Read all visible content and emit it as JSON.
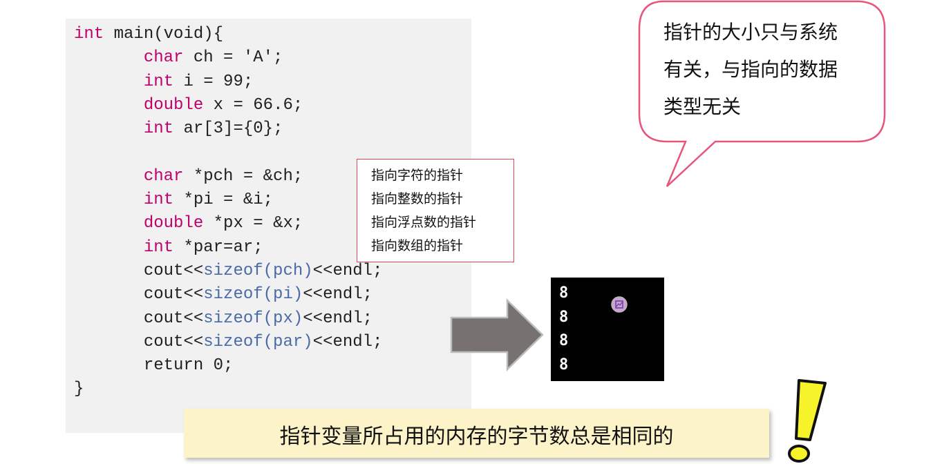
{
  "code": {
    "lines": [
      [
        {
          "t": "int",
          "k": "kw"
        },
        {
          "t": " main(void){",
          "k": ""
        }
      ],
      [
        {
          "t": "       ",
          "k": ""
        },
        {
          "t": "char",
          "k": "kw"
        },
        {
          "t": " ch = 'A';",
          "k": ""
        }
      ],
      [
        {
          "t": "       ",
          "k": ""
        },
        {
          "t": "int",
          "k": "kw"
        },
        {
          "t": " i = 99;",
          "k": ""
        }
      ],
      [
        {
          "t": "       ",
          "k": ""
        },
        {
          "t": "double",
          "k": "kw"
        },
        {
          "t": " x = 66.6;",
          "k": ""
        }
      ],
      [
        {
          "t": "       ",
          "k": ""
        },
        {
          "t": "int",
          "k": "kw"
        },
        {
          "t": " ar[3]={0};",
          "k": ""
        }
      ],
      [
        {
          "t": "",
          "k": ""
        }
      ],
      [
        {
          "t": "       ",
          "k": ""
        },
        {
          "t": "char",
          "k": "kw"
        },
        {
          "t": " *pch = &ch;",
          "k": ""
        }
      ],
      [
        {
          "t": "       ",
          "k": ""
        },
        {
          "t": "int",
          "k": "kw"
        },
        {
          "t": " *pi = &i;",
          "k": ""
        }
      ],
      [
        {
          "t": "       ",
          "k": ""
        },
        {
          "t": "double",
          "k": "kw"
        },
        {
          "t": " *px = &x;",
          "k": ""
        }
      ],
      [
        {
          "t": "       ",
          "k": ""
        },
        {
          "t": "int",
          "k": "kw"
        },
        {
          "t": " *par=ar;",
          "k": ""
        }
      ],
      [
        {
          "t": "       cout<<",
          "k": ""
        },
        {
          "t": "sizeof(pch)",
          "k": "fn"
        },
        {
          "t": "<<endl;",
          "k": ""
        }
      ],
      [
        {
          "t": "       cout<<",
          "k": ""
        },
        {
          "t": "sizeof(pi)",
          "k": "fn"
        },
        {
          "t": "<<endl;",
          "k": ""
        }
      ],
      [
        {
          "t": "       cout<<",
          "k": ""
        },
        {
          "t": "sizeof(px)",
          "k": "fn"
        },
        {
          "t": "<<endl;",
          "k": ""
        }
      ],
      [
        {
          "t": "       cout<<",
          "k": ""
        },
        {
          "t": "sizeof(par)",
          "k": "fn"
        },
        {
          "t": "<<endl;",
          "k": ""
        }
      ],
      [
        {
          "t": "       return 0;",
          "k": ""
        }
      ],
      [
        {
          "t": "}",
          "k": ""
        }
      ]
    ]
  },
  "annotations": [
    "指向字符的指针",
    "指向整数的指针",
    "指向浮点数的指针",
    "指向数组的指针"
  ],
  "console": {
    "output": [
      "8",
      "8",
      "8",
      "8"
    ]
  },
  "bubble": {
    "lines": [
      "指针的大小只与系统",
      "有关，与指向的数据",
      "类型无关"
    ]
  },
  "banner": {
    "text": "指针变量所占用的内存的字节数总是相同的"
  },
  "colors": {
    "keyword": "#c0006b",
    "function": "#4a6aa8",
    "annotation_border": "#e8434f",
    "bubble_border": "#e8557a",
    "banner_bg": "#fdf3c8",
    "exclaim": "#f7f32a"
  },
  "icons": {
    "arrow": "right-arrow-icon",
    "exclaim": "exclamation-icon",
    "cursor": "image-cursor-icon"
  }
}
